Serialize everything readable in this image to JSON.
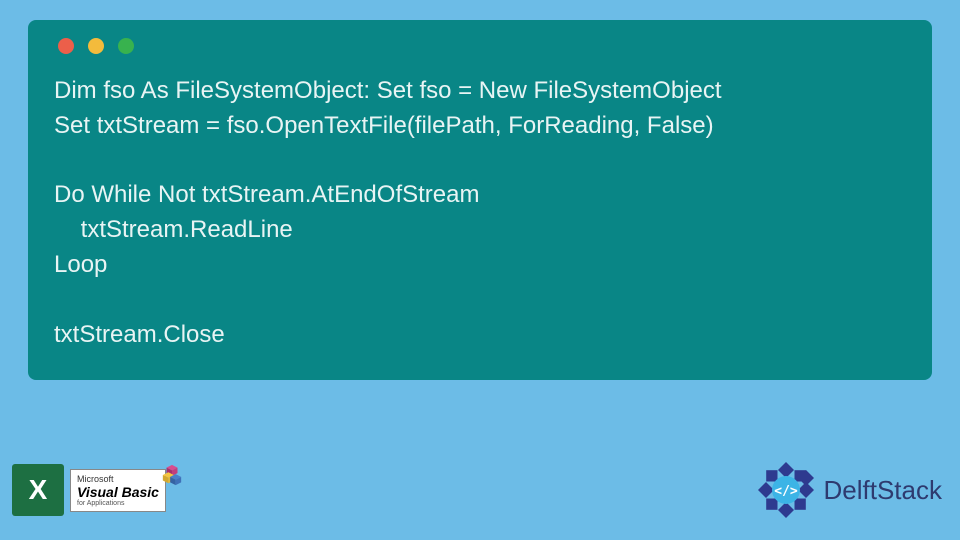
{
  "code": {
    "lines": [
      "Dim fso As FileSystemObject: Set fso = New FileSystemObject",
      "Set txtStream = fso.OpenTextFile(filePath, ForReading, False)",
      "",
      "Do While Not txtStream.AtEndOfStream",
      "    txtStream.ReadLine",
      "Loop",
      "",
      "txtStream.Close"
    ]
  },
  "footer": {
    "excel_label": "X",
    "vb": {
      "company": "Microsoft",
      "name": "Visual Basic",
      "sub": "for Applications"
    },
    "brand": "DelftStack"
  }
}
